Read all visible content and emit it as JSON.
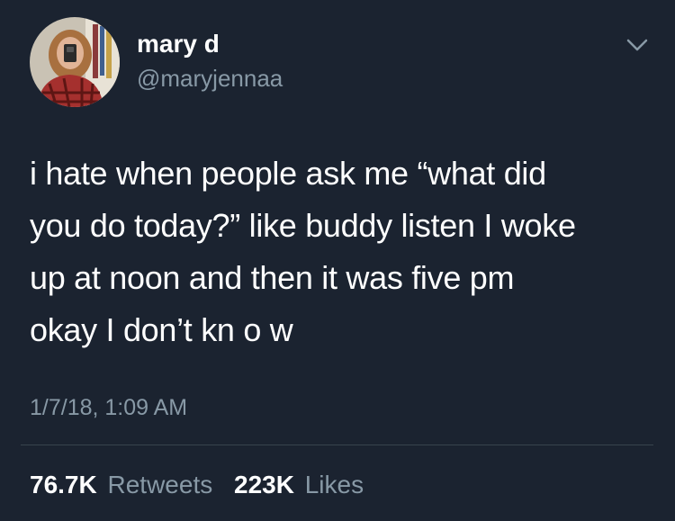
{
  "author": {
    "display_name": "mary d",
    "handle": "@maryjennaa",
    "avatar_icon": "profile-photo"
  },
  "menu": {
    "icon": "chevron-down-icon"
  },
  "tweet": {
    "lines": [
      "i hate when people ask me “what did",
      "you do today?” like buddy listen I woke",
      "up at noon and then it was five pm",
      "okay I don’t kn o w"
    ],
    "timestamp": "1/7/18, 1:09 AM"
  },
  "stats": {
    "retweets_count": "76.7K",
    "retweets_label": "Retweets",
    "likes_count": "223K",
    "likes_label": "Likes"
  },
  "colors": {
    "background": "#1b2330",
    "text": "#ffffff",
    "muted": "#8899a6",
    "divider": "#38444d"
  }
}
